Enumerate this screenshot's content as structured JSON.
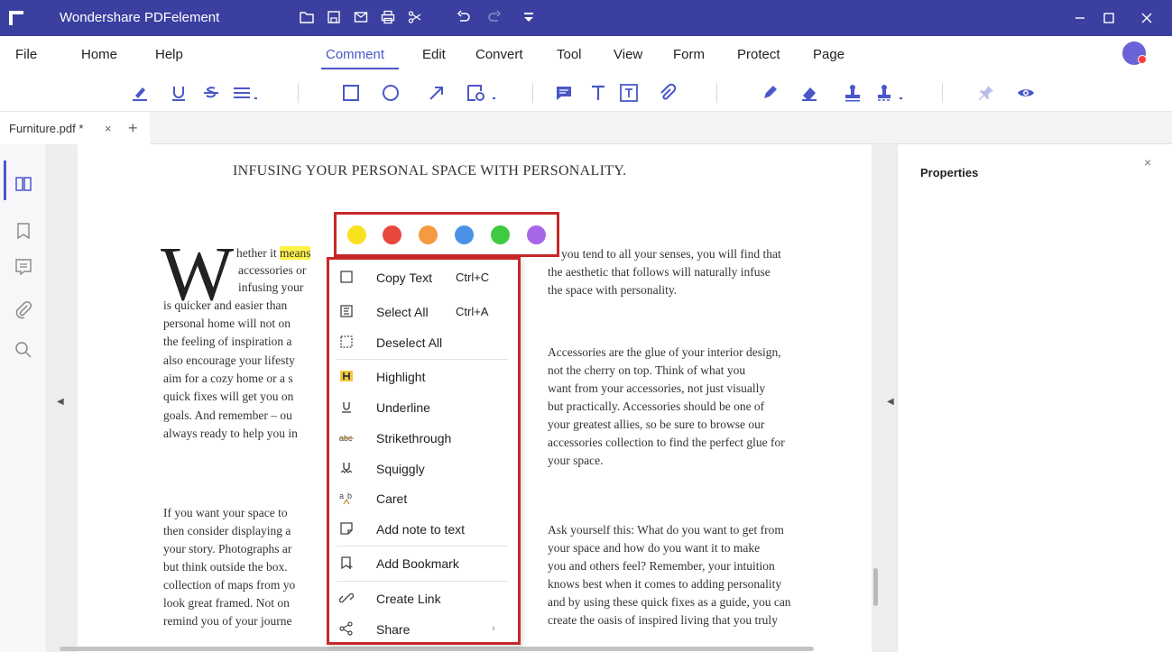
{
  "app": {
    "title": "Wondershare PDFelement"
  },
  "quick_access": [
    "folder-icon",
    "save-icon",
    "mail-icon",
    "print-icon",
    "share-icon",
    "undo-icon",
    "redo-icon",
    "customize-icon"
  ],
  "window_controls": [
    "minimize-icon",
    "maximize-icon",
    "close-icon"
  ],
  "menu": {
    "items": [
      {
        "key": "file",
        "label": "File"
      },
      {
        "key": "home",
        "label": "Home"
      },
      {
        "key": "help",
        "label": "Help"
      },
      {
        "key": "comment",
        "label": "Comment",
        "active": true
      },
      {
        "key": "edit",
        "label": "Edit"
      },
      {
        "key": "convert",
        "label": "Convert"
      },
      {
        "key": "tool",
        "label": "Tool"
      },
      {
        "key": "view",
        "label": "View"
      },
      {
        "key": "form",
        "label": "Form"
      },
      {
        "key": "protect",
        "label": "Protect"
      },
      {
        "key": "page",
        "label": "Page"
      }
    ]
  },
  "toolbar_icons": [
    "highlight-icon",
    "underline-icon",
    "strikethrough-icon",
    "text-align-icon",
    "rectangle-icon",
    "oval-icon",
    "arrow-icon",
    "shapes-icon",
    "sticky-note-icon",
    "typewriter-icon",
    "text-box-icon",
    "attachment-icon",
    "pencil-icon",
    "eraser-icon",
    "stamp-icon",
    "signature-icon",
    "pin-icon",
    "eye-icon"
  ],
  "tab": {
    "label": "Furniture.pdf *",
    "close": "×",
    "add": "+"
  },
  "document": {
    "title": "INFUSING YOUR PERSONAL SPACE WITH PERSONALITY.",
    "dropcap": "W",
    "col1_lines": [
      "hether it ",
      "accessories or",
      "infusing your",
      "is quicker and easier than",
      "personal home will not on",
      "the feeling of inspiration a",
      "also encourage your lifesty",
      "aim for a cozy home or a s",
      "quick fixes will get you on",
      "goals. And remember – ou",
      "always ready to help you in"
    ],
    "col1_highlight": "means",
    "col1b_lines": [
      "If you want your space to",
      "then consider displaying a",
      "your story. Photographs ar",
      "but think outside the box.",
      "collection of maps from yo",
      "look great framed. Not on",
      "remind you of your journe"
    ],
    "col2_p1": [
      "you tend to all your senses, you will find that",
      "the aesthetic that follows will naturally infuse",
      "the space with personality."
    ],
    "col2_p2": [
      "Accessories are the glue of your interior design,",
      "not the cherry on top. Think of what you",
      "want from your accessories, not just visually",
      "but practically. Accessories should be one of",
      "your greatest allies, so be sure to browse our",
      "accessories collection to find the perfect glue for",
      "your space."
    ],
    "col2_p3": [
      "Ask yourself this: What do you want to get from",
      "your space and how do you want it to make",
      "you and others feel? Remember, your intuition",
      "knows best when it comes to adding personality",
      "and by using these quick fixes as a guide, you can",
      "create the oasis of inspired living that you truly"
    ]
  },
  "color_palette": [
    "#f9e11e",
    "#e8473d",
    "#f59a42",
    "#4b92e6",
    "#3fca3f",
    "#a766e8"
  ],
  "context_menu": [
    {
      "label": "Copy Text",
      "shortcut": "Ctrl+C",
      "icon": "copy-icon"
    },
    {
      "label": "Select All",
      "shortcut": "Ctrl+A",
      "icon": "select-all-icon"
    },
    {
      "label": "Deselect All",
      "shortcut": "",
      "icon": "deselect-icon"
    },
    {
      "label": "Highlight",
      "shortcut": "",
      "icon": "highlight-icon"
    },
    {
      "label": "Underline",
      "shortcut": "",
      "icon": "underline-icon"
    },
    {
      "label": "Strikethrough",
      "shortcut": "",
      "icon": "strikethrough-icon"
    },
    {
      "label": "Squiggly",
      "shortcut": "",
      "icon": "squiggly-icon"
    },
    {
      "label": "Caret",
      "shortcut": "",
      "icon": "caret-icon"
    },
    {
      "label": "Add note to text",
      "shortcut": "",
      "icon": "note-icon"
    },
    {
      "label": "Add Bookmark",
      "shortcut": "",
      "icon": "bookmark-icon"
    },
    {
      "label": "Create Link",
      "shortcut": "",
      "icon": "link-icon"
    },
    {
      "label": "Share",
      "shortcut": "",
      "icon": "share-icon",
      "submenu": "›"
    }
  ],
  "left_sidebar": [
    "thumbnails-icon",
    "bookmarks-icon",
    "comments-icon",
    "attachments-icon",
    "search-icon"
  ],
  "properties": {
    "title": "Properties",
    "close": "×"
  }
}
